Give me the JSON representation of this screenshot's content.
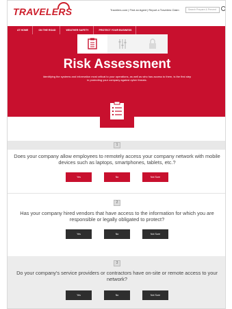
{
  "header": {
    "logo_text": "TRAVELERS",
    "top_links": "Travelers.com | Find an Agent | Report a Travelers Claim",
    "search_placeholder": "Search Prepare & Prevent"
  },
  "nav": {
    "items": [
      {
        "label": "At Home"
      },
      {
        "label": "On The Road"
      },
      {
        "label": "Weather Safety"
      },
      {
        "label": "Protect Your Business"
      }
    ]
  },
  "hero": {
    "title": "Risk Assessment",
    "subtitle": "Identifying the systems and information most critical to your operations, as well as who has access to them, is the first step in protecting your company against cyber threats.",
    "tab_icons": [
      "clipboard-icon",
      "sliders-icon",
      "lock-icon"
    ]
  },
  "questions": [
    {
      "number": "1",
      "text": "Does your company allow employees to remotely access your company network with mobile devices such as laptops, smartphones, tablets, etc.?",
      "answers": [
        "Yes",
        "No",
        "Not Sure"
      ],
      "style": "red"
    },
    {
      "number": "2",
      "text": "Has your company hired vendors that have access to the information for which you are responsible or legally obligated to protect?",
      "answers": [
        "Yes",
        "No",
        "Not Sure"
      ],
      "style": "dark"
    },
    {
      "number": "3",
      "text": "Do your company's service providers or contractors have on-site or remote access to your network?",
      "answers": [
        "Yes",
        "No",
        "Not Sure"
      ],
      "style": "dark"
    }
  ],
  "colors": {
    "brand_red": "#c8102e",
    "dark_button": "#2e2e2e",
    "question_bar": "#e8e8e8"
  }
}
